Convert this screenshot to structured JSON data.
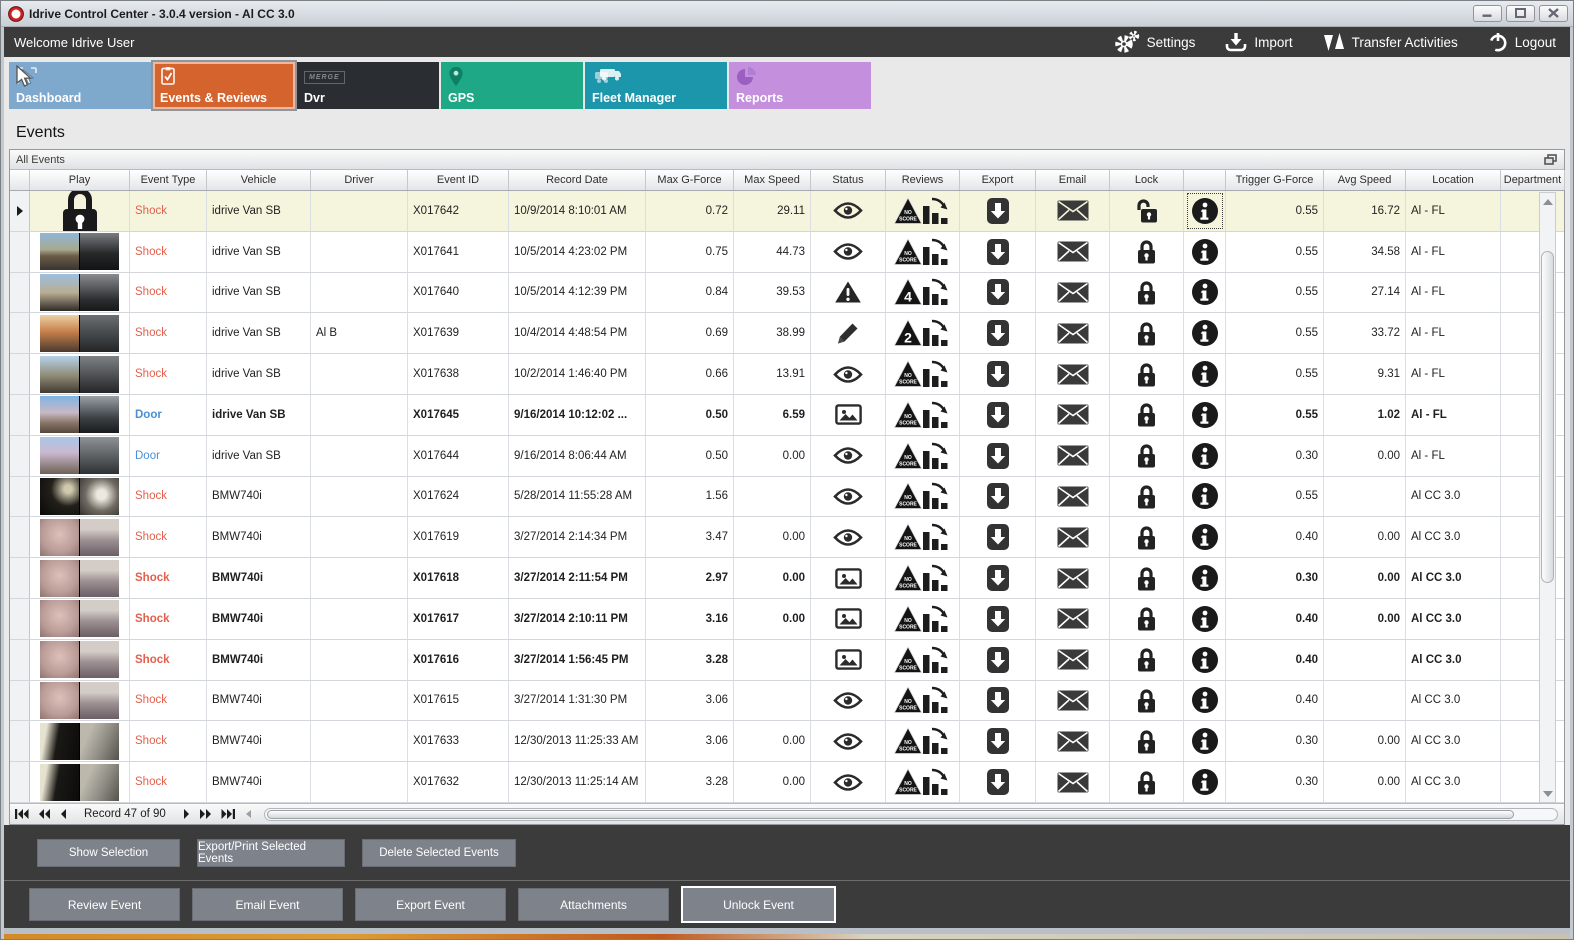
{
  "window": {
    "title": "Idrive Control Center - 3.0.4 version - Al CC 3.0",
    "controls": [
      "minimize",
      "maximize",
      "close"
    ]
  },
  "topbar": {
    "welcome": "Welcome Idrive User",
    "actions": [
      {
        "label": "Settings",
        "icon": "gears-icon"
      },
      {
        "label": "Import",
        "icon": "import-icon"
      },
      {
        "label": "Transfer Activities",
        "icon": "transfer-icon"
      },
      {
        "label": "Logout",
        "icon": "power-icon"
      }
    ]
  },
  "nav_tiles": [
    {
      "label": "Dashboard",
      "icon": "cursor-select-icon",
      "color": "#7fa8cd",
      "selected": false
    },
    {
      "label": "Events & Reviews",
      "icon": "clipboard-check-icon",
      "color": "#d4632e",
      "selected": true
    },
    {
      "label": "Dvr",
      "icon": "merge-box-icon",
      "color": "#2a2e32",
      "selected": false
    },
    {
      "label": "GPS",
      "icon": "map-pin-icon",
      "color": "#1ea885",
      "selected": false
    },
    {
      "label": "Fleet Manager",
      "icon": "trucks-icon",
      "color": "#1b96ab",
      "selected": false
    },
    {
      "label": "Reports",
      "icon": "pie-chart-icon",
      "color": "#c490dd",
      "selected": false
    }
  ],
  "page": {
    "title": "Events",
    "group_label": "All Events"
  },
  "table": {
    "columns": [
      "",
      "Play",
      "Event Type",
      "Vehicle",
      "Driver",
      "Event ID",
      "Record Date",
      "Max G-Force",
      "Max Speed",
      "Status",
      "Reviews",
      "Export",
      "Email",
      "Lock",
      "",
      "Trigger G-Force",
      "Avg Speed",
      "Location",
      "Department"
    ],
    "rows": [
      {
        "selected": true,
        "bold": false,
        "play": "lock",
        "thumb": "",
        "type": "Shock",
        "tcolor": "shock",
        "vehicle": "idrive Van SB",
        "driver": "",
        "id": "X017642",
        "date": "10/9/2014 8:10:01 AM",
        "maxg": "0.72",
        "maxspeed": "29.11",
        "status": "eye-icon",
        "reviews": "NO SCORE",
        "lock": "unlocked",
        "trigger": "0.55",
        "avg": "16.72",
        "loc": "Al - FL"
      },
      {
        "selected": false,
        "bold": false,
        "play": "thumb",
        "thumb": "van1",
        "type": "Shock",
        "tcolor": "shock",
        "vehicle": "idrive Van SB",
        "driver": "",
        "id": "X017641",
        "date": "10/5/2014 4:23:02 PM",
        "maxg": "0.75",
        "maxspeed": "44.73",
        "status": "eye-icon",
        "reviews": "NO SCORE",
        "lock": "locked",
        "trigger": "0.55",
        "avg": "34.58",
        "loc": "Al - FL"
      },
      {
        "selected": false,
        "bold": false,
        "play": "thumb",
        "thumb": "van2",
        "type": "Shock",
        "tcolor": "shock",
        "vehicle": "idrive Van SB",
        "driver": "",
        "id": "X017640",
        "date": "10/5/2014 4:12:39 PM",
        "maxg": "0.84",
        "maxspeed": "39.53",
        "status": "warning-icon",
        "reviews": "4",
        "lock": "locked",
        "trigger": "0.55",
        "avg": "27.14",
        "loc": "Al - FL"
      },
      {
        "selected": false,
        "bold": false,
        "play": "thumb",
        "thumb": "van3",
        "type": "Shock",
        "tcolor": "shock",
        "vehicle": "idrive Van SB",
        "driver": "Al B",
        "id": "X017639",
        "date": "10/4/2014 4:48:54 PM",
        "maxg": "0.69",
        "maxspeed": "38.99",
        "status": "pencil-icon",
        "reviews": "2",
        "lock": "locked",
        "trigger": "0.55",
        "avg": "33.72",
        "loc": "Al - FL"
      },
      {
        "selected": false,
        "bold": false,
        "play": "thumb",
        "thumb": "van4",
        "type": "Shock",
        "tcolor": "shock",
        "vehicle": "idrive Van SB",
        "driver": "",
        "id": "X017638",
        "date": "10/2/2014 1:46:40 PM",
        "maxg": "0.66",
        "maxspeed": "13.91",
        "status": "eye-icon",
        "reviews": "NO SCORE",
        "lock": "locked",
        "trigger": "0.55",
        "avg": "9.31",
        "loc": "Al - FL"
      },
      {
        "selected": false,
        "bold": true,
        "play": "thumb",
        "thumb": "door1",
        "type": "Door",
        "tcolor": "door",
        "vehicle": "idrive Van SB",
        "driver": "",
        "id": "X017645",
        "date": "9/16/2014 10:12:02 ...",
        "maxg": "0.50",
        "maxspeed": "6.59",
        "status": "image-icon",
        "reviews": "NO SCORE",
        "lock": "locked",
        "trigger": "0.55",
        "avg": "1.02",
        "loc": "Al - FL"
      },
      {
        "selected": false,
        "bold": false,
        "play": "thumb",
        "thumb": "door2",
        "type": "Door",
        "tcolor": "door",
        "vehicle": "idrive Van SB",
        "driver": "",
        "id": "X017644",
        "date": "9/16/2014 8:06:44 AM",
        "maxg": "0.50",
        "maxspeed": "0.00",
        "status": "eye-icon",
        "reviews": "NO SCORE",
        "lock": "locked",
        "trigger": "0.30",
        "avg": "0.00",
        "loc": "Al - FL"
      },
      {
        "selected": false,
        "bold": false,
        "play": "thumb",
        "thumb": "bmwdark",
        "type": "Shock",
        "tcolor": "shock",
        "vehicle": "BMW740i",
        "driver": "",
        "id": "X017624",
        "date": "5/28/2014 11:55:28 AM",
        "maxg": "1.56",
        "maxspeed": "",
        "status": "eye-icon",
        "reviews": "NO SCORE",
        "lock": "locked",
        "trigger": "0.55",
        "avg": "",
        "loc": "Al CC 3.0"
      },
      {
        "selected": false,
        "bold": false,
        "play": "thumb",
        "thumb": "pink",
        "type": "Shock",
        "tcolor": "shock",
        "vehicle": "BMW740i",
        "driver": "",
        "id": "X017619",
        "date": "3/27/2014 2:14:34 PM",
        "maxg": "3.47",
        "maxspeed": "0.00",
        "status": "eye-icon",
        "reviews": "NO SCORE",
        "lock": "locked",
        "trigger": "0.40",
        "avg": "0.00",
        "loc": "Al CC 3.0"
      },
      {
        "selected": false,
        "bold": true,
        "play": "thumb",
        "thumb": "pink",
        "type": "Shock",
        "tcolor": "shock",
        "vehicle": "BMW740i",
        "driver": "",
        "id": "X017618",
        "date": "3/27/2014 2:11:54 PM",
        "maxg": "2.97",
        "maxspeed": "0.00",
        "status": "image-icon",
        "reviews": "NO SCORE",
        "lock": "locked",
        "trigger": "0.30",
        "avg": "0.00",
        "loc": "Al CC 3.0"
      },
      {
        "selected": false,
        "bold": true,
        "play": "thumb",
        "thumb": "pink",
        "type": "Shock",
        "tcolor": "shock",
        "vehicle": "BMW740i",
        "driver": "",
        "id": "X017617",
        "date": "3/27/2014 2:10:11 PM",
        "maxg": "3.16",
        "maxspeed": "0.00",
        "status": "image-icon",
        "reviews": "NO SCORE",
        "lock": "locked",
        "trigger": "0.40",
        "avg": "0.00",
        "loc": "Al CC 3.0"
      },
      {
        "selected": false,
        "bold": true,
        "play": "thumb",
        "thumb": "pink",
        "type": "Shock",
        "tcolor": "shock",
        "vehicle": "BMW740i",
        "driver": "",
        "id": "X017616",
        "date": "3/27/2014 1:56:45 PM",
        "maxg": "3.28",
        "maxspeed": "",
        "status": "image-icon",
        "reviews": "NO SCORE",
        "lock": "locked",
        "trigger": "0.40",
        "avg": "",
        "loc": "Al CC 3.0"
      },
      {
        "selected": false,
        "bold": false,
        "play": "thumb",
        "thumb": "pink",
        "type": "Shock",
        "tcolor": "shock",
        "vehicle": "BMW740i",
        "driver": "",
        "id": "X017615",
        "date": "3/27/2014 1:31:30 PM",
        "maxg": "3.06",
        "maxspeed": "",
        "status": "eye-icon",
        "reviews": "NO SCORE",
        "lock": "locked",
        "trigger": "0.40",
        "avg": "",
        "loc": "Al CC 3.0"
      },
      {
        "selected": false,
        "bold": false,
        "play": "thumb",
        "thumb": "night",
        "type": "Shock",
        "tcolor": "shock",
        "vehicle": "BMW740i",
        "driver": "",
        "id": "X017633",
        "date": "12/30/2013 11:25:33 AM",
        "maxg": "3.06",
        "maxspeed": "0.00",
        "status": "eye-icon",
        "reviews": "NO SCORE",
        "lock": "locked",
        "trigger": "0.30",
        "avg": "0.00",
        "loc": "Al CC 3.0"
      },
      {
        "selected": false,
        "bold": false,
        "play": "thumb",
        "thumb": "night",
        "type": "Shock",
        "tcolor": "shock",
        "vehicle": "BMW740i",
        "driver": "",
        "id": "X017632",
        "date": "12/30/2013 11:25:14 AM",
        "maxg": "3.28",
        "maxspeed": "0.00",
        "status": "eye-icon",
        "reviews": "NO SCORE",
        "lock": "locked",
        "trigger": "0.30",
        "avg": "0.00",
        "loc": "Al CC 3.0"
      }
    ]
  },
  "record_nav": {
    "label": "Record 47 of 90"
  },
  "selection_buttons": [
    "Show Selection",
    "Export/Print Selected Events",
    "Delete Selected  Events"
  ],
  "event_buttons": [
    {
      "label": "Review Event",
      "focused": false
    },
    {
      "label": "Email Event",
      "focused": false
    },
    {
      "label": "Export Event",
      "focused": false
    },
    {
      "label": "Attachments",
      "focused": false
    },
    {
      "label": "Unlock Event",
      "focused": true
    }
  ],
  "colors": {
    "shock_text": "#e2604d",
    "door_text": "#4a90d2",
    "selected_row": "#f5f5dd",
    "dark_bar": "#3b3b3b",
    "selected_tile": "#d4632e"
  }
}
